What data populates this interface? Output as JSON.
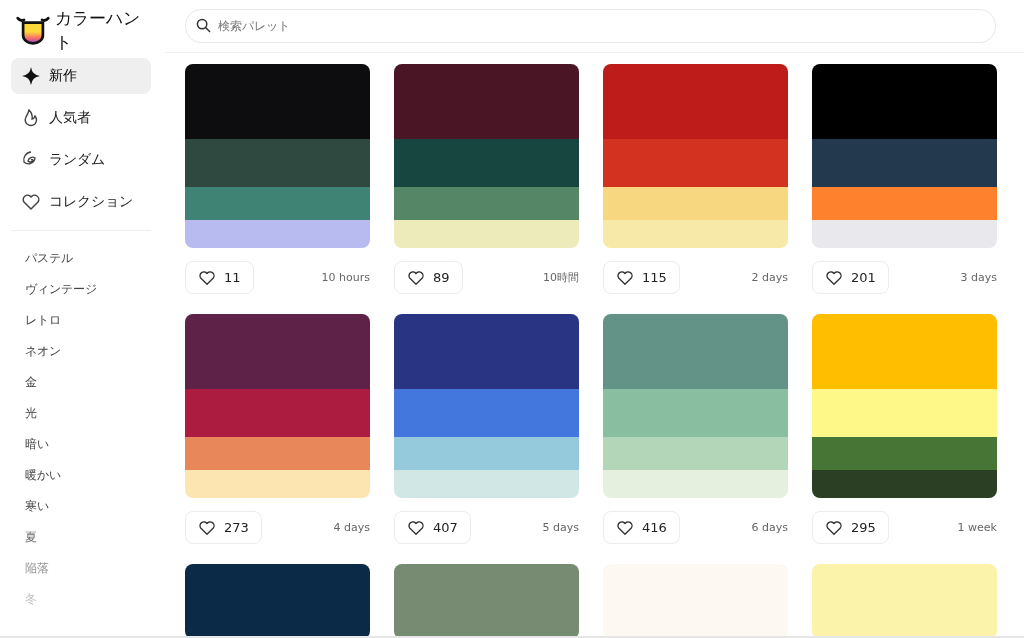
{
  "app": {
    "title": "カラーハント"
  },
  "search": {
    "placeholder": "検索パレット"
  },
  "nav": [
    {
      "label": "新作",
      "kind": "sparkle",
      "selected": true
    },
    {
      "label": "人気者",
      "kind": "flame",
      "selected": false
    },
    {
      "label": "ランダム",
      "kind": "spiral",
      "selected": false
    },
    {
      "label": "コレクション",
      "kind": "heart",
      "selected": false
    }
  ],
  "tags": [
    "パステル",
    "ヴィンテージ",
    "レトロ",
    "ネオン",
    "金",
    "光",
    "暗い",
    "暖かい",
    "寒い",
    "夏",
    "陥落",
    "冬"
  ],
  "palettes": [
    {
      "swatches": [
        {
          "color": "#0d0c0e"
        },
        {
          "color": "#2f4840"
        },
        {
          "color": "#3e8374"
        },
        {
          "color": "#b8bbf0"
        }
      ],
      "likes": "11",
      "age": "10 hours"
    },
    {
      "swatches": [
        {
          "color": "#4a1626"
        },
        {
          "color": "#174640"
        },
        {
          "color": "#558767"
        },
        {
          "color": "#eeebbb"
        }
      ],
      "likes": "89",
      "age": "10時間"
    },
    {
      "swatches": [
        {
          "color": "#bd1c1b"
        },
        {
          "color": "#d33221"
        },
        {
          "color": "#f7d880"
        },
        {
          "color": "#f7e9a8"
        }
      ],
      "likes": "115",
      "age": "2 days"
    },
    {
      "swatches": [
        {
          "color": "#000000"
        },
        {
          "color": "#233a4e"
        },
        {
          "color": "#fe822e"
        },
        {
          "color": "#e9e9ed"
        }
      ],
      "likes": "201",
      "age": "3 days"
    },
    {
      "swatches": [
        {
          "color": "#5e2249"
        },
        {
          "color": "#ac1c40"
        },
        {
          "color": "#e8885a"
        },
        {
          "color": "#fde5b1"
        }
      ],
      "likes": "273",
      "age": "4 days"
    },
    {
      "swatches": [
        {
          "color": "#293582"
        },
        {
          "color": "#4477dd"
        },
        {
          "color": "#94cadc"
        },
        {
          "color": "#d1e7e5"
        }
      ],
      "likes": "407",
      "age": "5 days"
    },
    {
      "swatches": [
        {
          "color": "#639386"
        },
        {
          "color": "#89bea0"
        },
        {
          "color": "#b3d6b8"
        },
        {
          "color": "#e5f1de"
        }
      ],
      "likes": "416",
      "age": "6 days"
    },
    {
      "swatches": [
        {
          "color": "#ffbe00"
        },
        {
          "color": "#fef888"
        },
        {
          "color": "#477536"
        },
        {
          "color": "#2b3f25"
        }
      ],
      "likes": "295",
      "age": "1 week"
    },
    {
      "swatches": [
        {
          "color": "#0b2a47"
        }
      ]
    },
    {
      "swatches": [
        {
          "color": "#778a72"
        }
      ]
    },
    {
      "swatches": [
        {
          "color": "#fdf8f1"
        }
      ]
    },
    {
      "swatches": [
        {
          "color": "#fcf3aa"
        }
      ]
    }
  ]
}
